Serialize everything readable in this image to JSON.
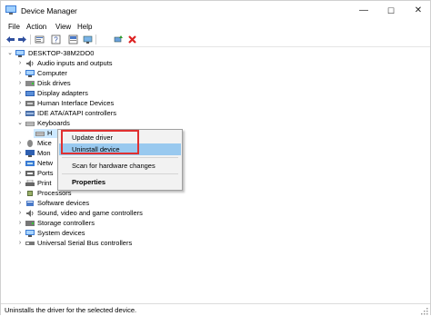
{
  "window": {
    "title": "Device Manager",
    "title_icon": "device-manager-icon",
    "min_glyph": "—",
    "max_glyph": "☐",
    "close_glyph": "✕"
  },
  "menu": {
    "file": "File",
    "action": "Action",
    "view": "View",
    "help": "Help"
  },
  "toolbar": [
    "back-arrow-icon",
    "forward-arrow-icon",
    "properties-icon",
    "help-icon",
    "update-driver-icon",
    "scan-hardware-icon",
    "add-legacy-icon",
    "uninstall-icon"
  ],
  "tree": {
    "root": "DESKTOP-38M2DO0",
    "items": [
      {
        "label": "Audio inputs and outputs",
        "icon": "speaker-icon"
      },
      {
        "label": "Computer",
        "icon": "computer-icon"
      },
      {
        "label": "Disk drives",
        "icon": "disk-icon"
      },
      {
        "label": "Display adapters",
        "icon": "display-icon"
      },
      {
        "label": "Human Interface Devices",
        "icon": "hid-icon"
      },
      {
        "label": "IDE ATA/ATAPI controllers",
        "icon": "ide-icon"
      },
      {
        "label": "Keyboards",
        "icon": "keyboard-icon"
      },
      {
        "label": "H",
        "icon": "keyboard-icon"
      },
      {
        "label": "Mice",
        "icon": "mouse-icon"
      },
      {
        "label": "Mon",
        "icon": "monitor-icon"
      },
      {
        "label": "Netw",
        "icon": "network-icon"
      },
      {
        "label": "Ports",
        "icon": "port-icon"
      },
      {
        "label": "Print",
        "icon": "printer-icon"
      },
      {
        "label": "Processors",
        "icon": "processor-icon"
      },
      {
        "label": "Software devices",
        "icon": "software-icon"
      },
      {
        "label": "Sound, video and game controllers",
        "icon": "sound-icon"
      },
      {
        "label": "Storage controllers",
        "icon": "storage-icon"
      },
      {
        "label": "System devices",
        "icon": "system-icon"
      },
      {
        "label": "Universal Serial Bus controllers",
        "icon": "usb-icon"
      }
    ]
  },
  "context_menu": {
    "update": "Update driver",
    "uninstall": "Uninstall device",
    "scan": "Scan for hardware changes",
    "properties": "Properties"
  },
  "status": {
    "text": "Uninstalls the driver for the selected device."
  },
  "colors": {
    "highlight": "#99c9ef",
    "red_box": "#e03030",
    "selected": "#cce8ff"
  }
}
